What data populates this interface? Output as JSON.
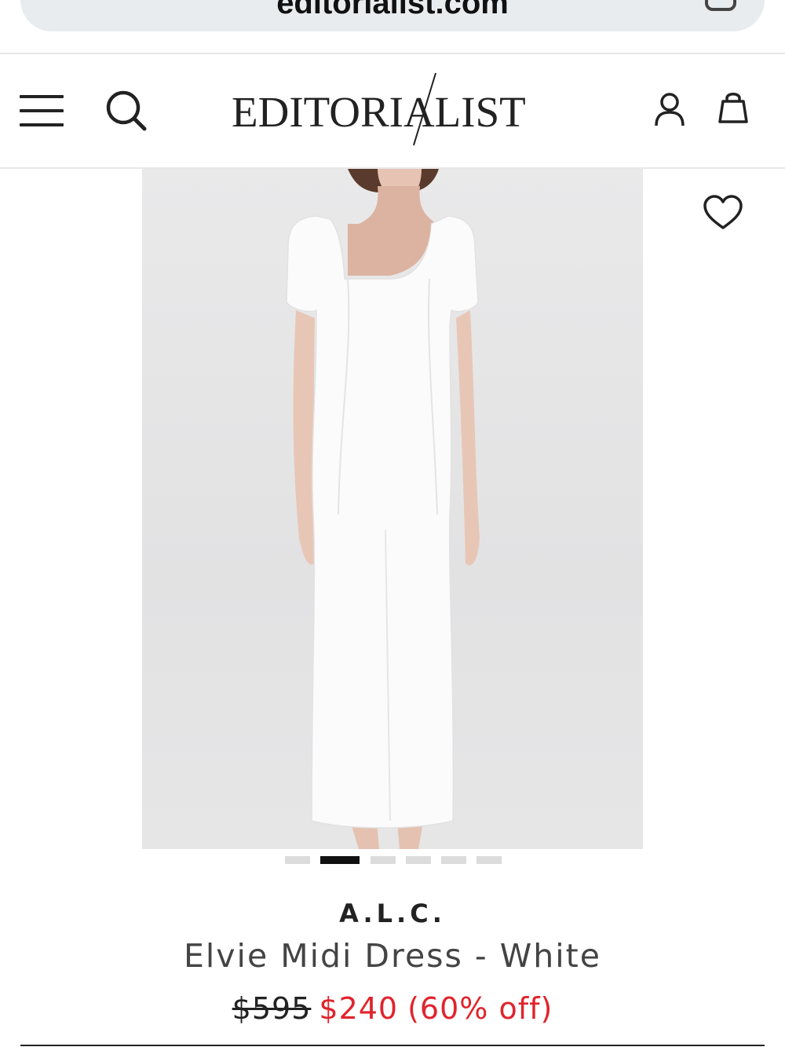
{
  "browser": {
    "url": "editorialist.com"
  },
  "header": {
    "logo_text": "EDITORIALIST",
    "icons": [
      "menu-icon",
      "search-icon",
      "account-icon",
      "bag-icon"
    ]
  },
  "product": {
    "image_alt": "Model wearing white short-sleeve square-neck midi dress",
    "wishlist_icon": "heart-icon",
    "carousel": {
      "total": 6,
      "active_index": 1
    },
    "brand": "A.L.C.",
    "name": "Elvie Midi Dress - White",
    "price_original": "$595",
    "price_sale": "$240",
    "discount": "(60% off)"
  },
  "colors": {
    "sale": "#e0242c",
    "text": "#222222",
    "image_bg": "#e4e4e5"
  }
}
